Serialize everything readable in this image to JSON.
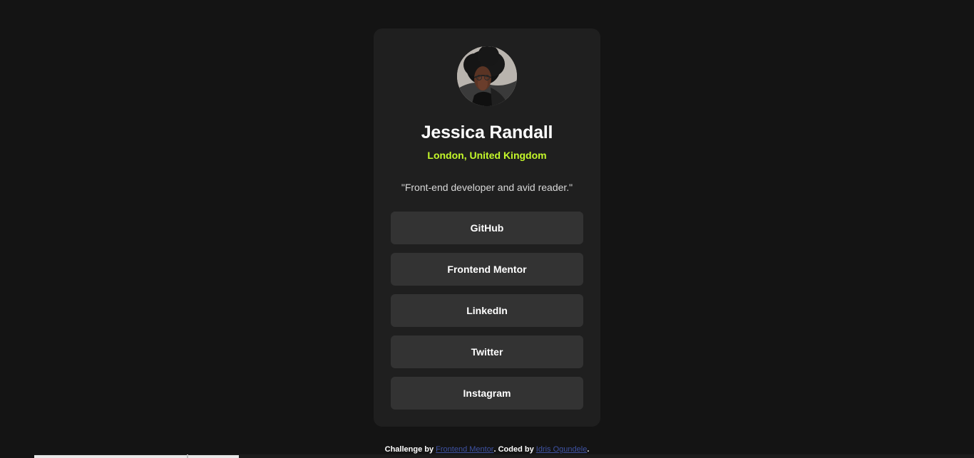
{
  "profile": {
    "name": "Jessica Randall",
    "location": "London, United Kingdom",
    "bio": "\"Front-end developer and avid reader.\"",
    "avatar_alt": "Profile photo"
  },
  "links": [
    {
      "label": "GitHub"
    },
    {
      "label": "Frontend Mentor"
    },
    {
      "label": "LinkedIn"
    },
    {
      "label": "Twitter"
    },
    {
      "label": "Instagram"
    }
  ],
  "footer": {
    "challenge_text": "Challenge by ",
    "challenge_link": "Frontend Mentor",
    "coded_text": ". Coded by ",
    "coded_link": "Idris Ogundele",
    "end_text": "."
  },
  "colors": {
    "background": "#141414",
    "card": "#1f1f1f",
    "button": "#333333",
    "accent": "#c4f82a",
    "text": "#ffffff",
    "muted_text": "#d8d8d8",
    "footer_link": "#3e52a3"
  }
}
